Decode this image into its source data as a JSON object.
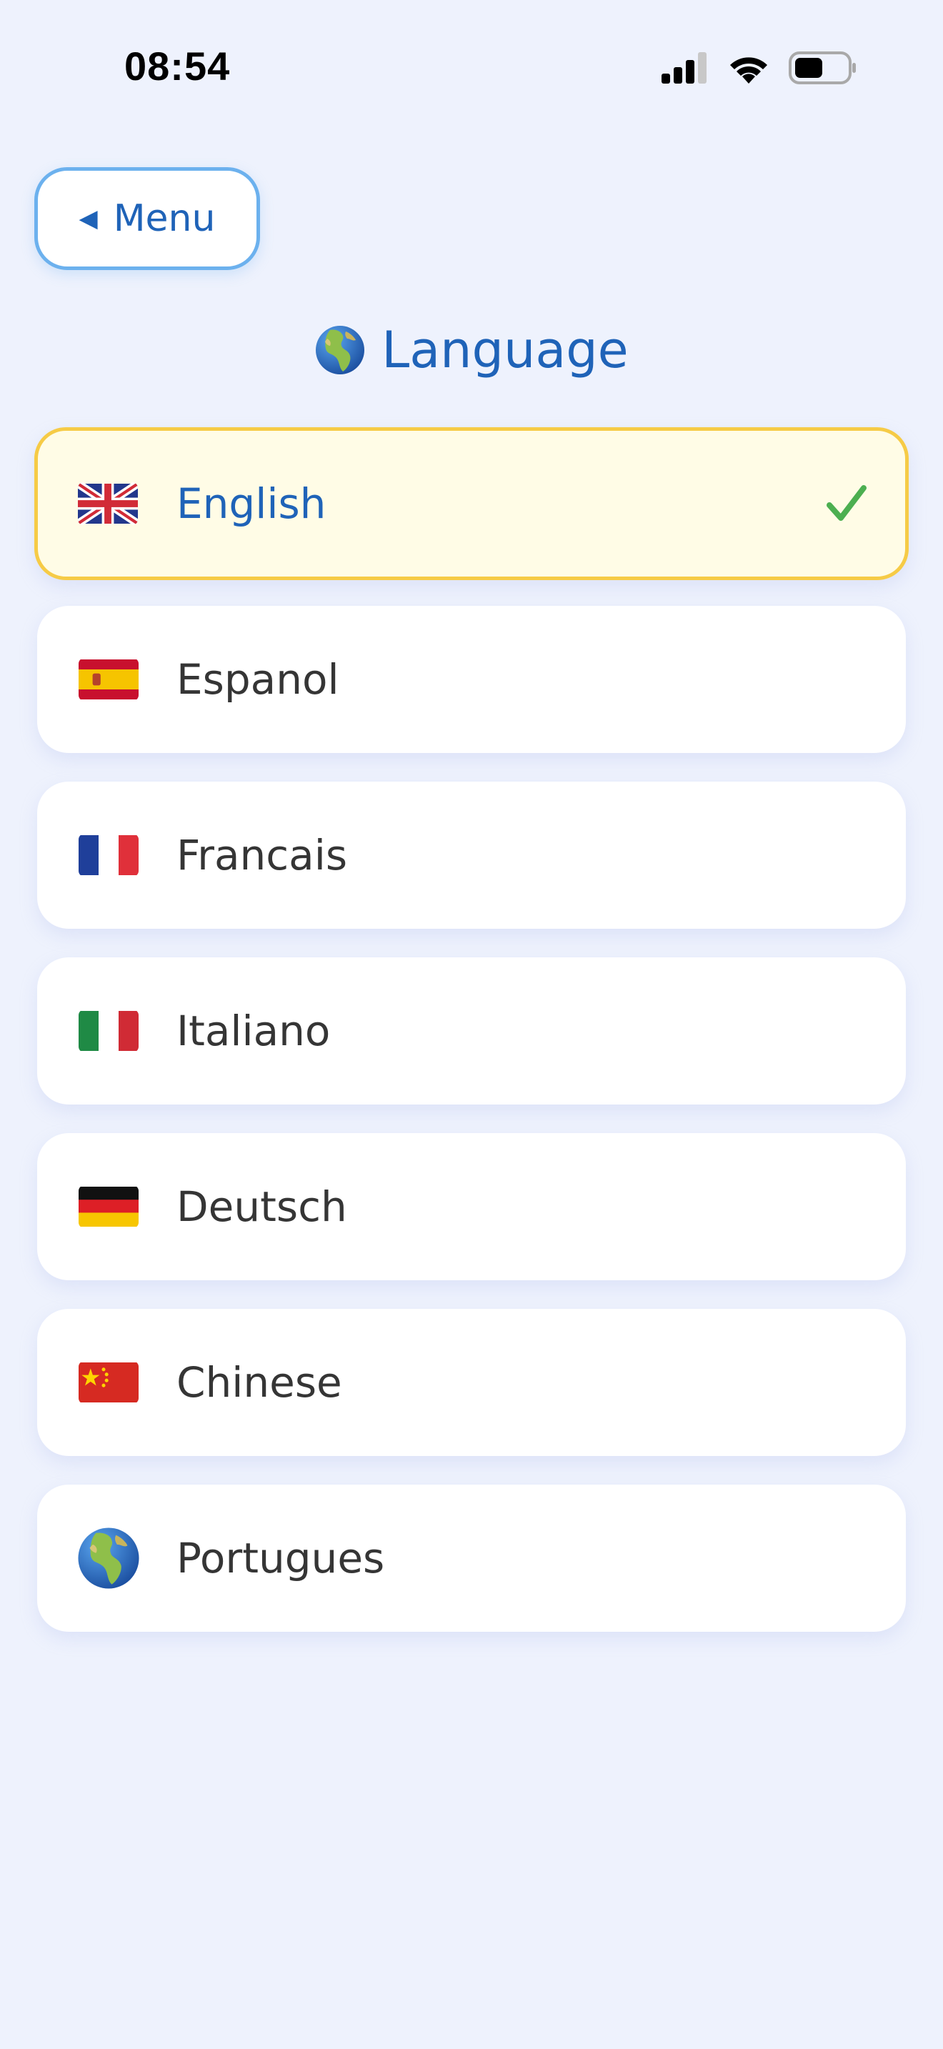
{
  "status_bar": {
    "time": "08:54"
  },
  "header": {
    "back_button_label": "Menu",
    "back_arrow": "◀",
    "title": "Language",
    "title_icon": "globe-icon"
  },
  "languages": [
    {
      "label": "English",
      "flag": "uk-flag-icon",
      "selected": true
    },
    {
      "label": "Espanol",
      "flag": "spain-flag-icon",
      "selected": false
    },
    {
      "label": "Francais",
      "flag": "france-flag-icon",
      "selected": false
    },
    {
      "label": "Italiano",
      "flag": "italy-flag-icon",
      "selected": false
    },
    {
      "label": "Deutsch",
      "flag": "germany-flag-icon",
      "selected": false
    },
    {
      "label": "Chinese",
      "flag": "china-flag-icon",
      "selected": false
    },
    {
      "label": "Portugues",
      "flag": "globe-icon",
      "selected": false
    }
  ],
  "colors": {
    "background": "#eef2fd",
    "accent_blue": "#1f63b8",
    "button_border": "#6cb1ee",
    "selected_border": "#f6cb46",
    "selected_bg": "#fffce6",
    "check_green": "#4caf50"
  }
}
